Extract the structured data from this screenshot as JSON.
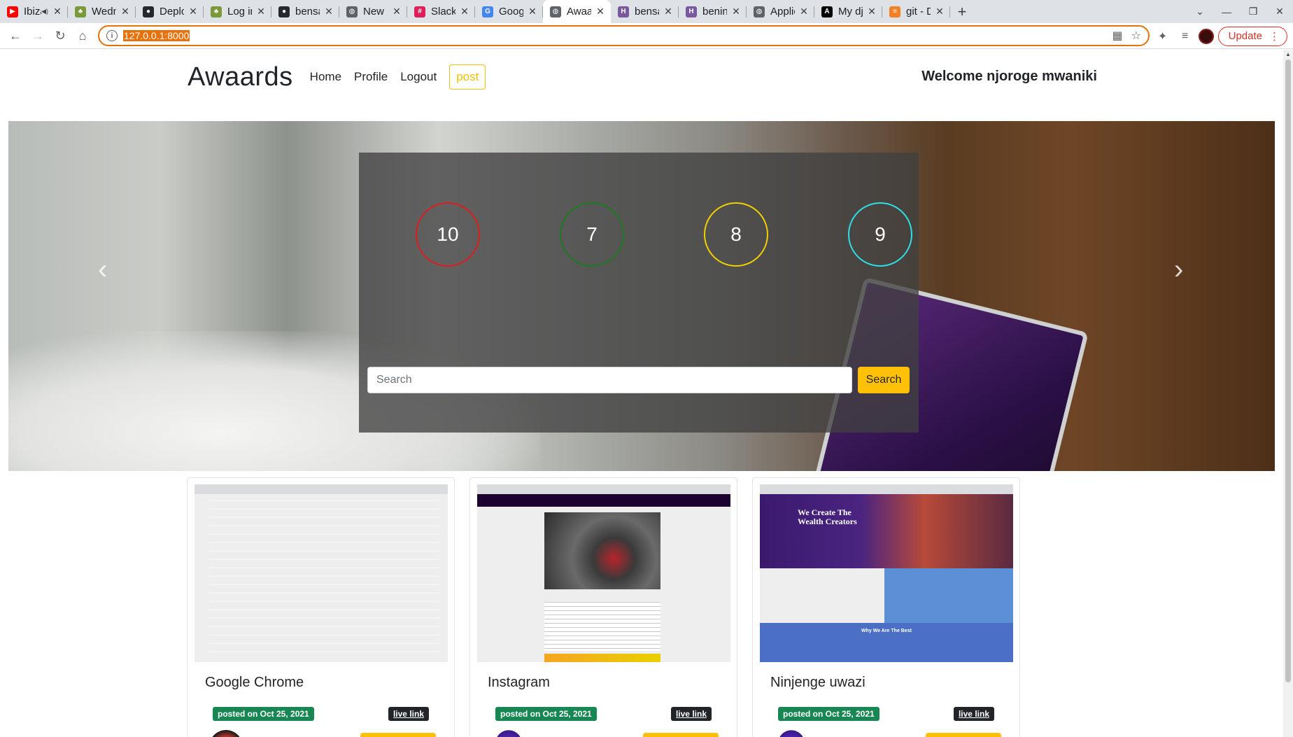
{
  "browser": {
    "tabs": [
      {
        "title": "Ibiza",
        "icon": "youtube-icon",
        "color": "#ff0000",
        "muted": true
      },
      {
        "title": "Wednes",
        "icon": "palm-icon",
        "color": "#7a9a3a"
      },
      {
        "title": "Deploy",
        "icon": "github-icon",
        "color": "#24292f"
      },
      {
        "title": "Log in t",
        "icon": "palm-icon",
        "color": "#7a9a3a"
      },
      {
        "title": "bensam",
        "icon": "github-icon",
        "color": "#24292f"
      },
      {
        "title": "New Ins",
        "icon": "globe-icon",
        "color": "#5f6368"
      },
      {
        "title": "Slack | H",
        "icon": "slack-icon",
        "color": "#e01e5a"
      },
      {
        "title": "Google",
        "icon": "google-icon",
        "color": "#4285f4"
      },
      {
        "title": "Awaard",
        "icon": "globe-icon",
        "color": "#5f6368",
        "active": true
      },
      {
        "title": "bensam",
        "icon": "heroku-icon",
        "color": "#79589f"
      },
      {
        "title": "beninst",
        "icon": "heroku-icon",
        "color": "#79589f"
      },
      {
        "title": "Applica",
        "icon": "globe-icon",
        "color": "#5f6368"
      },
      {
        "title": "My djan",
        "icon": "vercel-icon",
        "color": "#000000"
      },
      {
        "title": "git - Dja",
        "icon": "stack-icon",
        "color": "#f48024"
      }
    ],
    "url": "127.0.0.1:8000",
    "update_label": "Update"
  },
  "nav": {
    "brand": "Awaards",
    "links": [
      "Home",
      "Profile",
      "Logout"
    ],
    "post_label": "post",
    "welcome": "Welcome njoroge mwaniki"
  },
  "hero": {
    "scores": [
      {
        "value": "10",
        "color": "#dc1e1e"
      },
      {
        "value": "7",
        "color": "#1e7a1e"
      },
      {
        "value": "8",
        "color": "#f0d000"
      },
      {
        "value": "9",
        "color": "#2de0e6"
      }
    ],
    "search_placeholder": "Search",
    "search_button": "Search"
  },
  "projects": [
    {
      "title": "Google Chrome",
      "posted": "posted on Oct 25, 2021",
      "live": "live link"
    },
    {
      "title": "Instagram",
      "posted": "posted on Oct 25, 2021",
      "live": "live link"
    },
    {
      "title": "Ninjenge uwazi",
      "posted": "posted on Oct 25, 2021",
      "live": "live link"
    }
  ],
  "thumb3_heading": "We Create The Wealth Creators",
  "thumb3_section": "Why We Are The Best"
}
